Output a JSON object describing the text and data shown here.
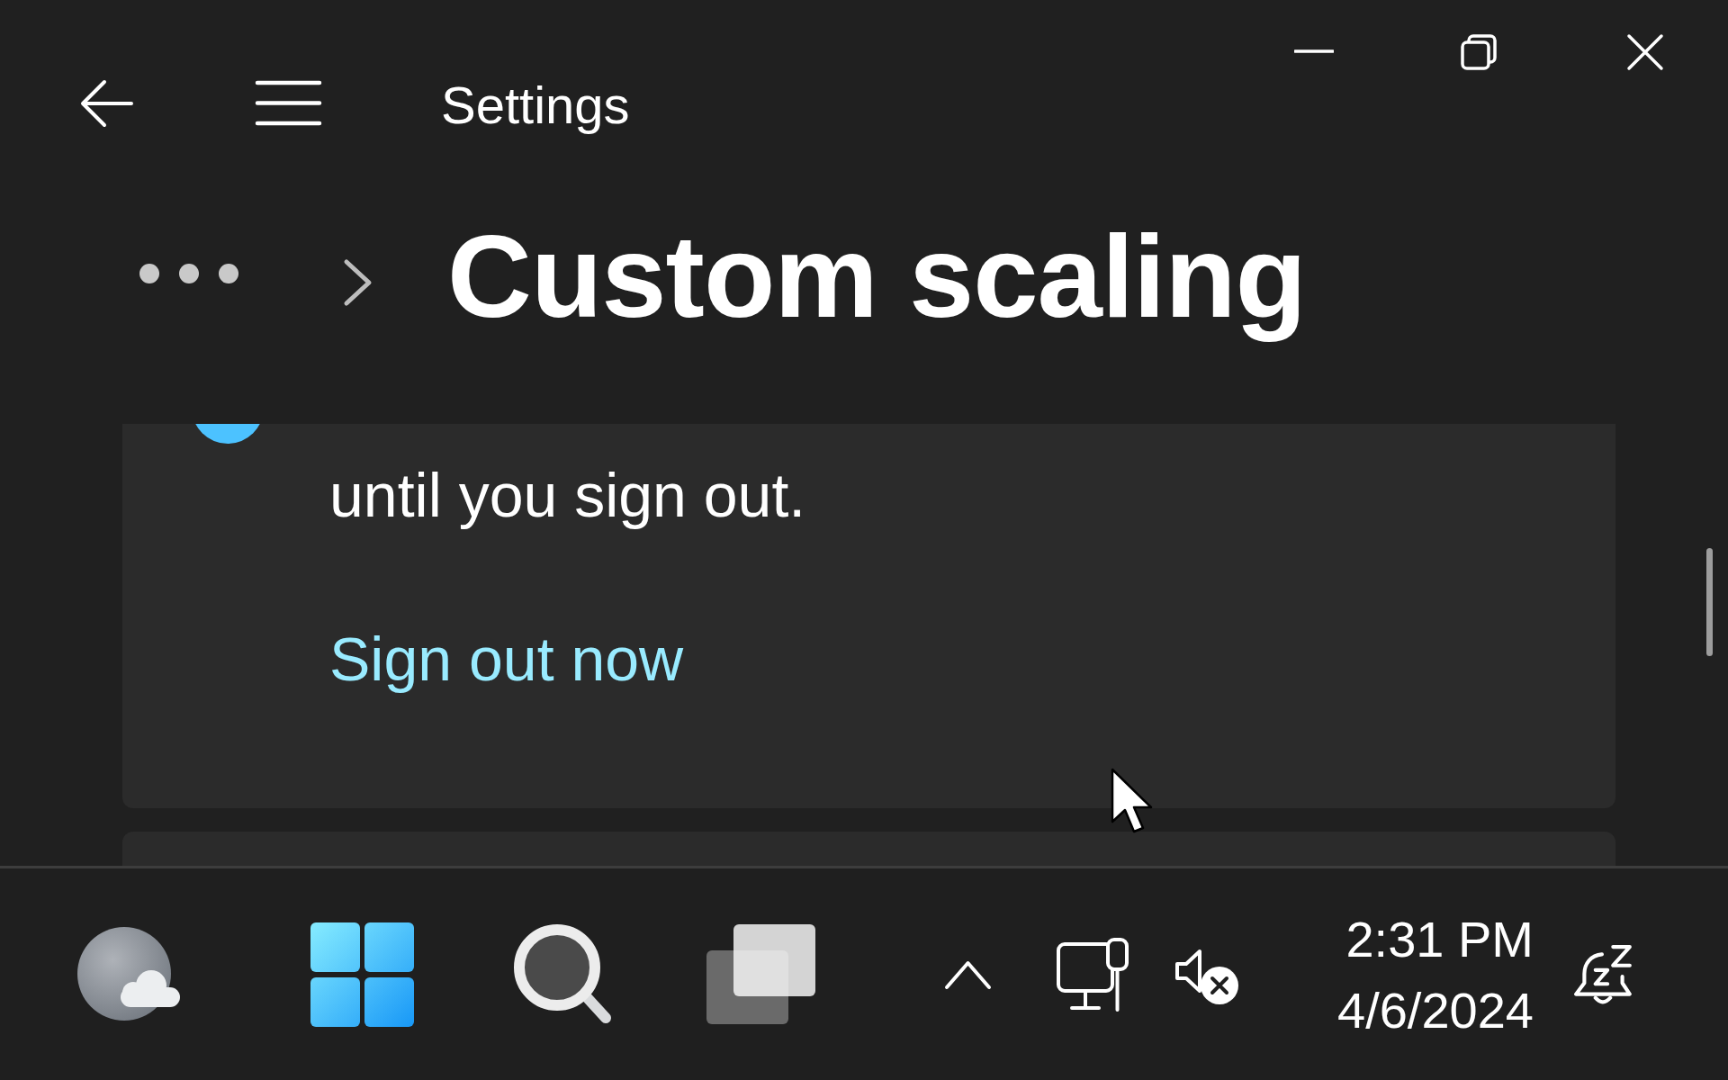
{
  "window": {
    "title": "Settings"
  },
  "breadcrumb": {
    "title": "Custom scaling"
  },
  "notice": {
    "message": "until you sign out.",
    "link": "Sign out now"
  },
  "taskbar": {
    "time": "2:31 PM",
    "date": "4/6/2024"
  }
}
